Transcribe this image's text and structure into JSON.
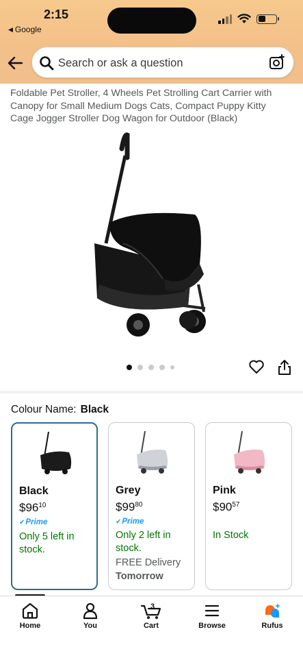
{
  "status_bar": {
    "time": "2:15",
    "back_app": "Google"
  },
  "search": {
    "placeholder": "Search or ask a question"
  },
  "product": {
    "title": "Foldable Pet Stroller, 4 Wheels Pet Strolling Cart Carrier with Canopy for Small Medium Dogs Cats, Compact Puppy Kitty Cage Jogger Stroller Dog Wagon for Outdoor (Black)",
    "image_count": 5,
    "active_image": 1
  },
  "variations": {
    "label": "Colour Name:",
    "selected": "Black",
    "options": [
      {
        "name": "Black",
        "price_whole": "$96",
        "price_fraction": "10",
        "prime": "Prime",
        "stock": "Only 5 left in stock.",
        "delivery": "",
        "delivery_day": "",
        "color": "#1b1b1b"
      },
      {
        "name": "Grey",
        "price_whole": "$99",
        "price_fraction": "80",
        "prime": "Prime",
        "stock": "Only 2 left in stock.",
        "delivery": "FREE Delivery",
        "delivery_day": "Tomorrow",
        "color": "#cfd2d6"
      },
      {
        "name": "Pink",
        "price_whole": "$90",
        "price_fraction": "57",
        "prime": "",
        "stock": "In Stock",
        "delivery": "",
        "delivery_day": "",
        "color": "#f2b8c6"
      }
    ]
  },
  "bottom_nav": {
    "items": [
      {
        "label": "Home",
        "icon": "home-icon"
      },
      {
        "label": "You",
        "icon": "user-icon"
      },
      {
        "label": "Cart",
        "icon": "cart-icon",
        "badge": "3"
      },
      {
        "label": "Browse",
        "icon": "menu-icon"
      },
      {
        "label": "Rufus",
        "icon": "rufus-icon"
      }
    ]
  },
  "colors": {
    "header": "#f3c089",
    "prime_blue": "#1a98ff",
    "stock_green": "#007600",
    "selected_border": "#2b6d8e"
  }
}
